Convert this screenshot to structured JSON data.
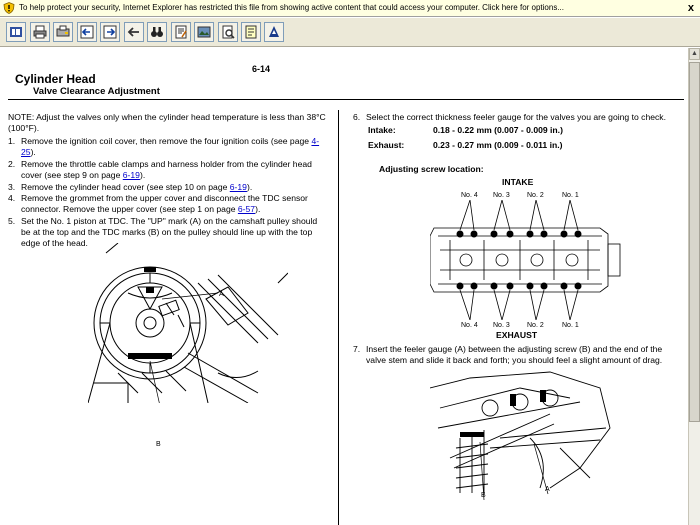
{
  "infobar": {
    "message": "To help protect your security, Internet Explorer has restricted this file from showing active content that could access your computer. Click here for options...",
    "close": "x"
  },
  "toolbar": {
    "buttons": [
      {
        "name": "index-icon"
      },
      {
        "name": "print-icon"
      },
      {
        "name": "print-selection-icon"
      },
      {
        "name": "previous-page-icon"
      },
      {
        "name": "next-page-icon"
      },
      {
        "name": "back-icon"
      },
      {
        "name": "binoculars-icon"
      },
      {
        "name": "document-edit-icon"
      },
      {
        "name": "image-view-icon"
      },
      {
        "name": "page-zoom-icon"
      },
      {
        "name": "notes-icon"
      },
      {
        "name": "logo-icon"
      }
    ]
  },
  "page": {
    "page_number": "6-14",
    "title": "Cylinder Head",
    "subtitle": "Valve Clearance Adjustment",
    "note": "NOTE: Adjust the valves only when the cylinder head temperature is less than 38°C (100°F).",
    "steps_left": [
      {
        "num": "1.",
        "lines": [
          "Remove the ignition coil cover, then remove the four ignition coils (see page "
        ],
        "link": "4-25",
        "link_split": [
          "4-",
          "25"
        ],
        "after": ")."
      },
      {
        "num": "2.",
        "line1": "Remove the throttle cable clamps and harness holder from the cylinder head",
        "line2_pre": "cover (see step 9 on page ",
        "link": "6-19",
        "after": ")."
      },
      {
        "num": "3.",
        "line1_pre": "Remove the cylinder head cover (see step 10 on page ",
        "link": "6-19",
        "after": ")."
      },
      {
        "num": "4.",
        "line1": "Remove the grommet from the upper cover and disconnect the TDC sensor",
        "line2_pre": "connector. Remove the upper cover (see step 1 on page ",
        "link": "6-57",
        "after": ")."
      },
      {
        "num": "5.",
        "line1": "Set the No. 1 piston at TDC. The \"UP\" mark (A) on the camshaft pulley should",
        "line2": "be at the top and the TDC marks (B) on the pulley should line up with the top",
        "line3": "edge of the head."
      }
    ],
    "step6": {
      "num": "6.",
      "text": "Select the correct thickness feeler gauge for the valves you are going to check.",
      "intake_label": "Intake:",
      "intake_value": "0.18 - 0.22 mm (0.007 - 0.009 in.)",
      "exhaust_label": "Exhaust:",
      "exhaust_value": "0.23 - 0.27 mm (0.009 - 0.011 in.)"
    },
    "adjusting_heading": "Adjusting screw location:",
    "intake_heading": "INTAKE",
    "exhaust_heading": "EXHAUST",
    "cyl_labels_top": [
      "No. 4",
      "No. 3",
      "No. 2",
      "No. 1"
    ],
    "cyl_labels_bottom": [
      "No. 4",
      "No. 3",
      "No. 2",
      "No. 1"
    ],
    "step7": {
      "num": "7.",
      "line1": "Insert the feeler gauge (A) between the adjusting screw (B) and the end of the",
      "line2": "valve stem and slide it back and forth; you should feel a slight amount of drag."
    },
    "fig_left_labels": {
      "a": "A",
      "b": "B"
    },
    "fig_right_labels": {
      "a": "A",
      "b": "B"
    }
  },
  "scrollbar": {
    "up": "▲"
  }
}
